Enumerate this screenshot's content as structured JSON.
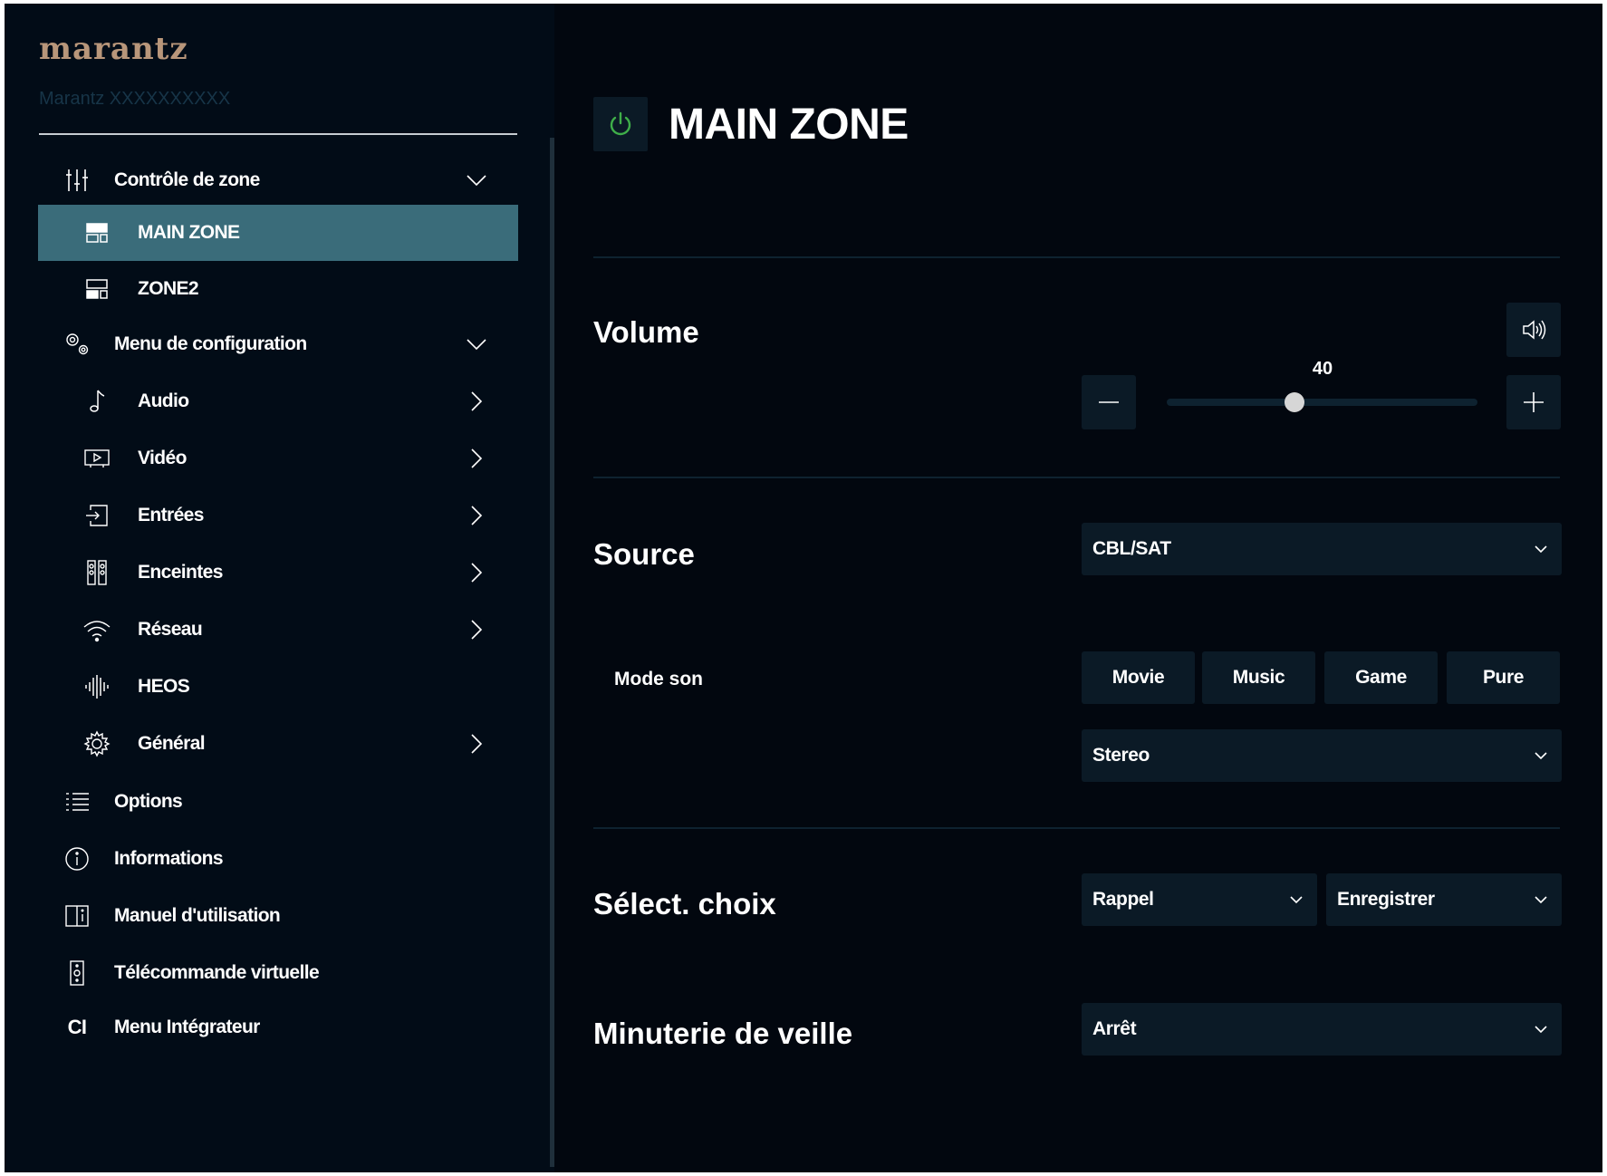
{
  "brand": {
    "logo": "marantz",
    "device_name": "Marantz XXXXXXXXXX"
  },
  "sidebar": {
    "items": [
      {
        "label": "Contrôle de zone",
        "icon": "sliders-icon",
        "trail": "chevron-down"
      },
      {
        "label": "MAIN ZONE",
        "icon": "main-zone-icon",
        "active": true
      },
      {
        "label": "ZONE2",
        "icon": "zone2-icon"
      },
      {
        "label": "Menu de configuration",
        "icon": "gears-icon",
        "trail": "chevron-down"
      },
      {
        "label": "Audio",
        "icon": "music-note-icon",
        "trail": "chevron-right"
      },
      {
        "label": "Vidéo",
        "icon": "video-icon",
        "trail": "chevron-right"
      },
      {
        "label": "Entrées",
        "icon": "input-icon",
        "trail": "chevron-right"
      },
      {
        "label": "Enceintes",
        "icon": "speakers-icon",
        "trail": "chevron-right"
      },
      {
        "label": "Réseau",
        "icon": "wifi-icon",
        "trail": "chevron-right"
      },
      {
        "label": "HEOS",
        "icon": "heos-icon"
      },
      {
        "label": "Général",
        "icon": "gear-icon",
        "trail": "chevron-right"
      },
      {
        "label": "Options",
        "icon": "list-icon"
      },
      {
        "label": "Informations",
        "icon": "info-icon"
      },
      {
        "label": "Manuel d'utilisation",
        "icon": "book-icon"
      },
      {
        "label": "Télécommande virtuelle",
        "icon": "remote-icon"
      },
      {
        "label": "Menu Intégrateur",
        "icon": "ci-icon",
        "icon_text": "CI"
      }
    ]
  },
  "main": {
    "zone_title": "MAIN ZONE",
    "power_state_color": "#3fae49",
    "volume": {
      "label": "Volume",
      "value": "40",
      "level_fraction": 0.41
    },
    "source": {
      "label": "Source",
      "selected": "CBL/SAT"
    },
    "sound_mode": {
      "label": "Mode son",
      "buttons": [
        "Movie",
        "Music",
        "Game",
        "Pure"
      ],
      "selected": "Stereo"
    },
    "quick_select": {
      "label": "Sélect. choix",
      "recall": "Rappel",
      "save": "Enregistrer"
    },
    "sleep_timer": {
      "label": "Minuterie de veille",
      "selected": "Arrêt"
    }
  },
  "colors": {
    "background": "#02070f",
    "sidebar": "#020c17",
    "active_item": "#3a6c7a",
    "control": "#0b1a26",
    "logo": "#b8967a",
    "power": "#3fae49"
  }
}
